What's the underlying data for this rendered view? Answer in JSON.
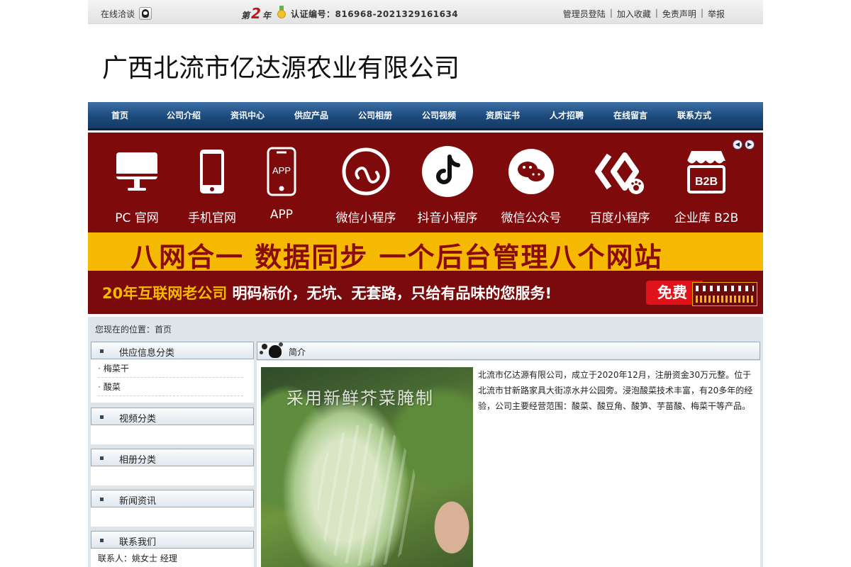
{
  "topbar": {
    "chat_label": "在线洽谈",
    "year_prefix": "第",
    "year_number": "2",
    "year_suffix": "年",
    "cert_text": "认证编号：816968-2021329161634",
    "links": [
      "管理员登陆",
      "加入收藏",
      "免责声明",
      "举报"
    ],
    "separator": "|"
  },
  "company_name": "广西北流市亿达源农业有限公司",
  "nav": {
    "items": [
      "首页",
      "公司介绍",
      "资讯中心",
      "供应产品",
      "公司相册",
      "公司视频",
      "资质证书",
      "人才招聘",
      "在线留言",
      "联系方式"
    ]
  },
  "banner": {
    "platforms": [
      {
        "label": "PC 官网",
        "icon": "desktop-monitor-icon"
      },
      {
        "label": "手机官网",
        "icon": "mobile-phone-icon"
      },
      {
        "label": "APP",
        "icon": "app-phone-icon",
        "icon_text": "APP"
      },
      {
        "label": "微信小程序",
        "icon": "wechat-miniprogram-icon"
      },
      {
        "label": "抖音小程序",
        "icon": "douyin-icon"
      },
      {
        "label": "微信公众号",
        "icon": "wechat-icon"
      },
      {
        "label": "百度小程序",
        "icon": "baidu-miniprogram-icon"
      },
      {
        "label": "企业库 B2B",
        "icon": "b2b-shop-icon",
        "icon_text": "B2B"
      }
    ],
    "headline": "八网合一  数据同步  一个后台管理八个网站",
    "slogan_part1": "20年互联网老公司 ",
    "slogan_part2": "明码标价，无坑、无套路，只给有品味的您服务!",
    "free_label": "免费",
    "colors": {
      "maroon": "#7e0a0b",
      "yellow": "#f4b900",
      "red_button": "#e0131a"
    }
  },
  "breadcrumb": "您现在的位置：首页",
  "sidebar": {
    "supply": {
      "title": "供应信息分类",
      "items": [
        "梅菜干",
        "酸菜"
      ]
    },
    "video": {
      "title": "视频分类"
    },
    "album": {
      "title": "相册分类"
    },
    "news": {
      "title": "新闻资讯"
    },
    "contact": {
      "title": "联系我们",
      "person": "联系人：姚女士 经理"
    }
  },
  "main": {
    "section_title": "简介",
    "photo_caption": "采用新鲜芥菜腌制",
    "intro_text": "北流市亿达源有限公司，成立于2020年12月，注册资金30万元整。位于北流市甘新路家具大街凉水井公园旁。浸泡酸菜技术丰富，有20多年的经验，公司主要经营范围：酸菜、酸豆角、酸笋、芋苗酸、梅菜干等产品。"
  }
}
